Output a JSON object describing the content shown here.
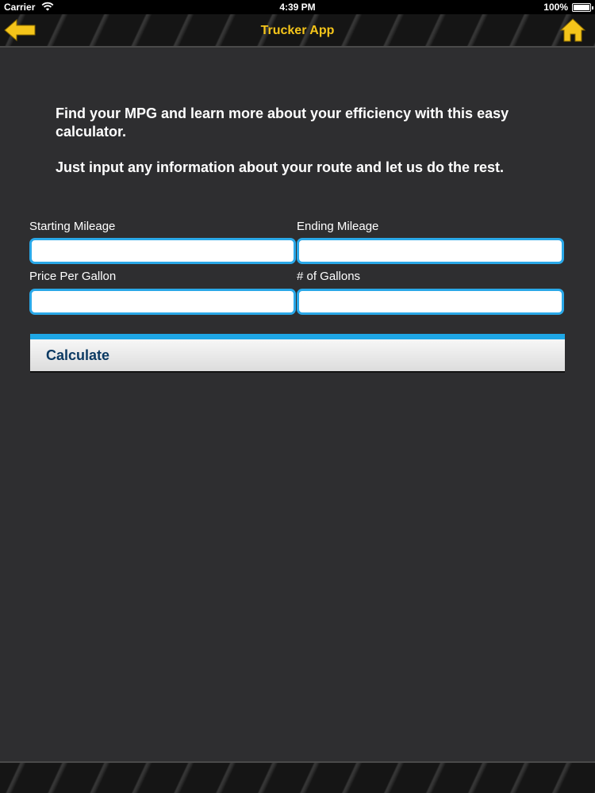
{
  "status_bar": {
    "carrier": "Carrier",
    "time": "4:39 PM",
    "battery": "100%"
  },
  "nav": {
    "title": "Trucker App",
    "back_icon": "back-arrow-icon",
    "home_icon": "home-icon",
    "accent_color": "#f5c51a"
  },
  "intro": {
    "line1": "Find your MPG and learn more about your efficiency with this easy calculator.",
    "line2": "Just input any information about your route and let us do the rest."
  },
  "form": {
    "starting_mileage": {
      "label": "Starting Mileage",
      "value": ""
    },
    "ending_mileage": {
      "label": "Ending Mileage",
      "value": ""
    },
    "price_per_gallon": {
      "label": "Price Per Gallon",
      "value": ""
    },
    "gallons": {
      "label": "# of Gallons",
      "value": ""
    },
    "input_border_color": "#2aa8e8"
  },
  "calculate": {
    "label": "Calculate",
    "accent_color": "#1ea7e6"
  }
}
